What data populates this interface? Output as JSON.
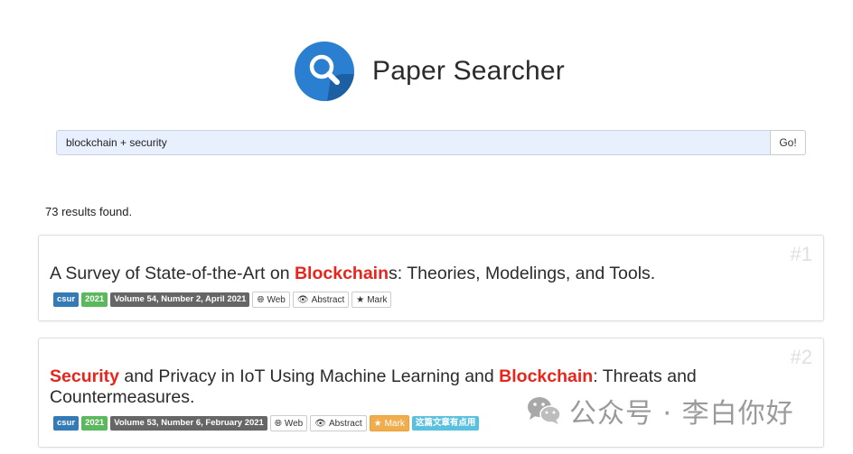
{
  "app": {
    "title": "Paper Searcher"
  },
  "search": {
    "value": "blockchain + security",
    "go_label": "Go!"
  },
  "results": {
    "count_text": "73 results found.",
    "items": [
      {
        "rank": "#1",
        "title_parts": [
          {
            "text": "A Survey of State-of-the-Art on ",
            "hl": false
          },
          {
            "text": "Blockchain",
            "hl": true
          },
          {
            "text": "s: Theories, Modelings, and Tools.",
            "hl": false
          }
        ],
        "venue": "csur",
        "year": "2021",
        "volume": "Volume 54, Number 2, April 2021",
        "web_label": "Web",
        "abstract_label": "Abstract",
        "mark_label": "Mark",
        "marked": false
      },
      {
        "rank": "#2",
        "title_parts": [
          {
            "text": "Security",
            "hl": true
          },
          {
            "text": " and Privacy in IoT Using Machine Learning and ",
            "hl": false
          },
          {
            "text": "Blockchain",
            "hl": true
          },
          {
            "text": ": Threats and Countermeasures.",
            "hl": false
          }
        ],
        "venue": "csur",
        "year": "2021",
        "volume": "Volume 53, Number 6, February 2021",
        "web_label": "Web",
        "abstract_label": "Abstract",
        "mark_label": "Mark",
        "marked": true,
        "note": "这篇文章有点用"
      }
    ]
  },
  "watermark": {
    "text": "公众号 · 李白你好",
    "icon": "wechat-icon"
  },
  "colors": {
    "highlight": "#e8251c",
    "venue_badge": "#337ab7",
    "year_badge": "#5cb85c",
    "volume_badge": "#666666",
    "mark_active": "#f0ad4e",
    "note_badge": "#5bc0de",
    "logo": "#2a7fd0"
  }
}
